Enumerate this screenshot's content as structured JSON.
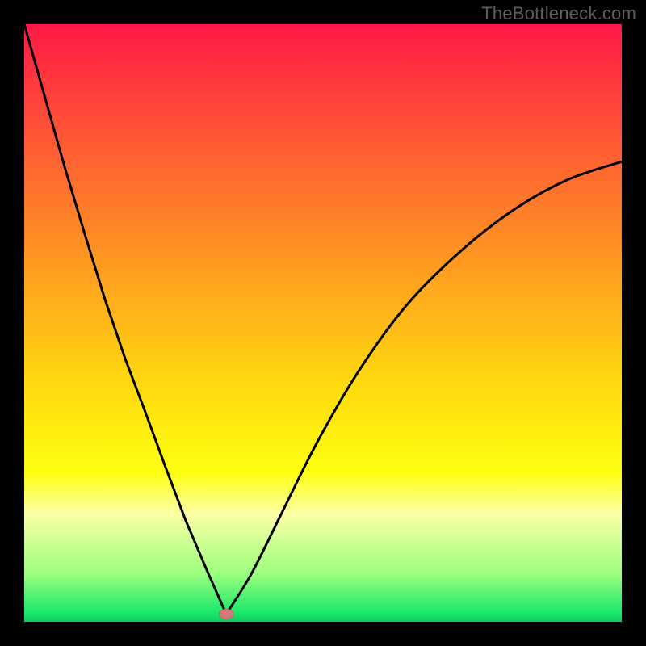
{
  "watermark": "TheBottleneck.com",
  "colors": {
    "frame": "#000000",
    "watermark": "#5f5f5f",
    "curve": "#000000",
    "marker_fill": "#d17a7a",
    "marker_stroke": "#b86a6a",
    "gradient_stops": [
      {
        "offset": 0.0,
        "color": "#ff1846"
      },
      {
        "offset": 0.2,
        "color": "#ff5a34"
      },
      {
        "offset": 0.4,
        "color": "#ff9a21"
      },
      {
        "offset": 0.6,
        "color": "#ffd90f"
      },
      {
        "offset": 0.75,
        "color": "#ffff11"
      },
      {
        "offset": 0.82,
        "color": "#fbffa6"
      },
      {
        "offset": 0.92,
        "color": "#9bff7e"
      },
      {
        "offset": 0.985,
        "color": "#19e86a"
      },
      {
        "offset": 1.0,
        "color": "#13ca5c"
      }
    ]
  },
  "chart_data": {
    "type": "line",
    "title": "",
    "xlabel": "",
    "ylabel": "",
    "axes_visible": false,
    "x_range": [
      0,
      100
    ],
    "y_range": [
      0,
      100
    ],
    "background": "vertical red→yellow→green gradient (bottleneck heat)",
    "curve_description": "Two-branch V curve with single minimum at x≈33.8, y≈1.3",
    "minimum_point": {
      "x": 33.8,
      "y": 1.3
    },
    "marker_at_minimum": true,
    "series": [
      {
        "name": "left-branch",
        "x": [
          0.0,
          3.4,
          6.8,
          10.1,
          13.5,
          16.9,
          20.3,
          23.6,
          27.0,
          30.4,
          33.8
        ],
        "y": [
          100.0,
          88.0,
          76.0,
          65.0,
          54.0,
          44.0,
          35.0,
          26.0,
          17.0,
          9.0,
          1.3
        ]
      },
      {
        "name": "right-branch",
        "x": [
          33.8,
          38.0,
          43.0,
          49.0,
          56.0,
          64.0,
          73.0,
          82.0,
          91.0,
          100.0
        ],
        "y": [
          1.3,
          8.0,
          18.0,
          30.0,
          42.0,
          53.0,
          62.0,
          69.0,
          74.0,
          77.0
        ]
      }
    ]
  }
}
